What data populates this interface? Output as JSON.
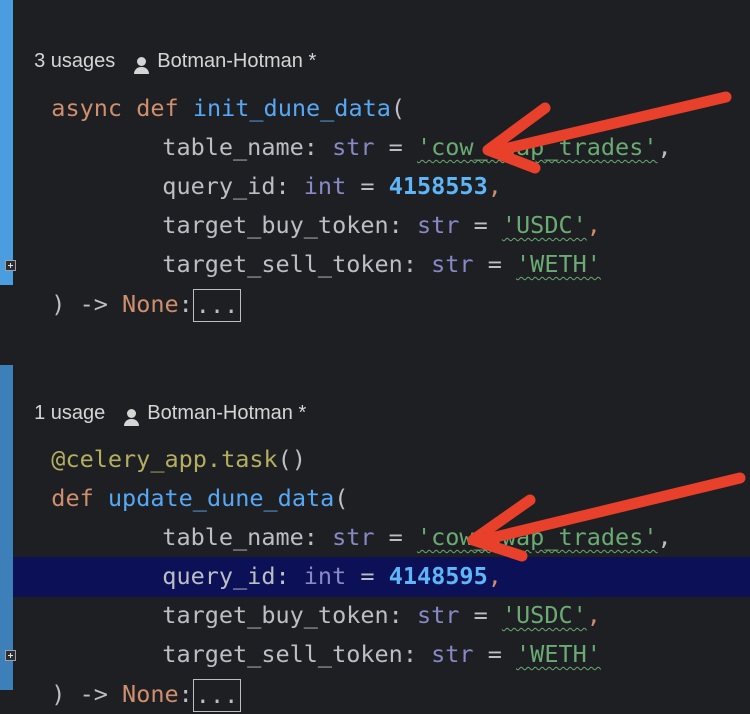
{
  "block1": {
    "hint_usages": "3 usages",
    "hint_author": "Botman-Hotman *",
    "kw_async": "async",
    "kw_def": "def",
    "fn_name": "init_dune_data",
    "open_paren": "(",
    "p1_name": "table_name",
    "p1_type": "str",
    "p1_value": "'cow_swap_trades'",
    "p2_name": "query_id",
    "p2_type": "int",
    "p2_value": "4158553",
    "p3_name": "target_buy_token",
    "p3_type": "str",
    "p3_value": "'USDC'",
    "p4_name": "target_sell_token",
    "p4_type": "str",
    "p4_value": "'WETH'",
    "close": ") -> ",
    "ret": "None",
    "colon": ":",
    "ellipsis": "..."
  },
  "block2": {
    "hint_usages": "1 usage",
    "hint_author": "Botman-Hotman *",
    "decorator": "@celery_app.task",
    "decorator_parens": "()",
    "kw_def": "def",
    "fn_name": "update_dune_data",
    "open_paren": "(",
    "p1_name": "table_name",
    "p1_type": "str",
    "p1_value": "'cow_swap_trades'",
    "p2_name": "query_id",
    "p2_type": "int",
    "p2_value": "4148595",
    "p3_name": "target_buy_token",
    "p3_type": "str",
    "p3_value": "'USDC'",
    "p4_name": "target_sell_token",
    "p4_type": "str",
    "p4_value": "'WETH'",
    "close": ") -> ",
    "ret": "None",
    "colon": ":",
    "ellipsis": "..."
  },
  "syntax": {
    "colon_sep": ": ",
    "equals": " = ",
    "comma": ","
  },
  "colors": {
    "background": "#1e1f22",
    "gutter_modified": "#4a9ee0",
    "current_line": "#0c1157",
    "keyword": "#cf8e6d",
    "function": "#56a8f5",
    "string": "#6aab73",
    "number": "#5eb5f7",
    "type": "#8888c6",
    "annotation_arrow": "#e8402a"
  },
  "icons": {
    "author": "person-icon",
    "fold": "fold-expand-icon",
    "arrow": "red-annotation-arrow"
  }
}
